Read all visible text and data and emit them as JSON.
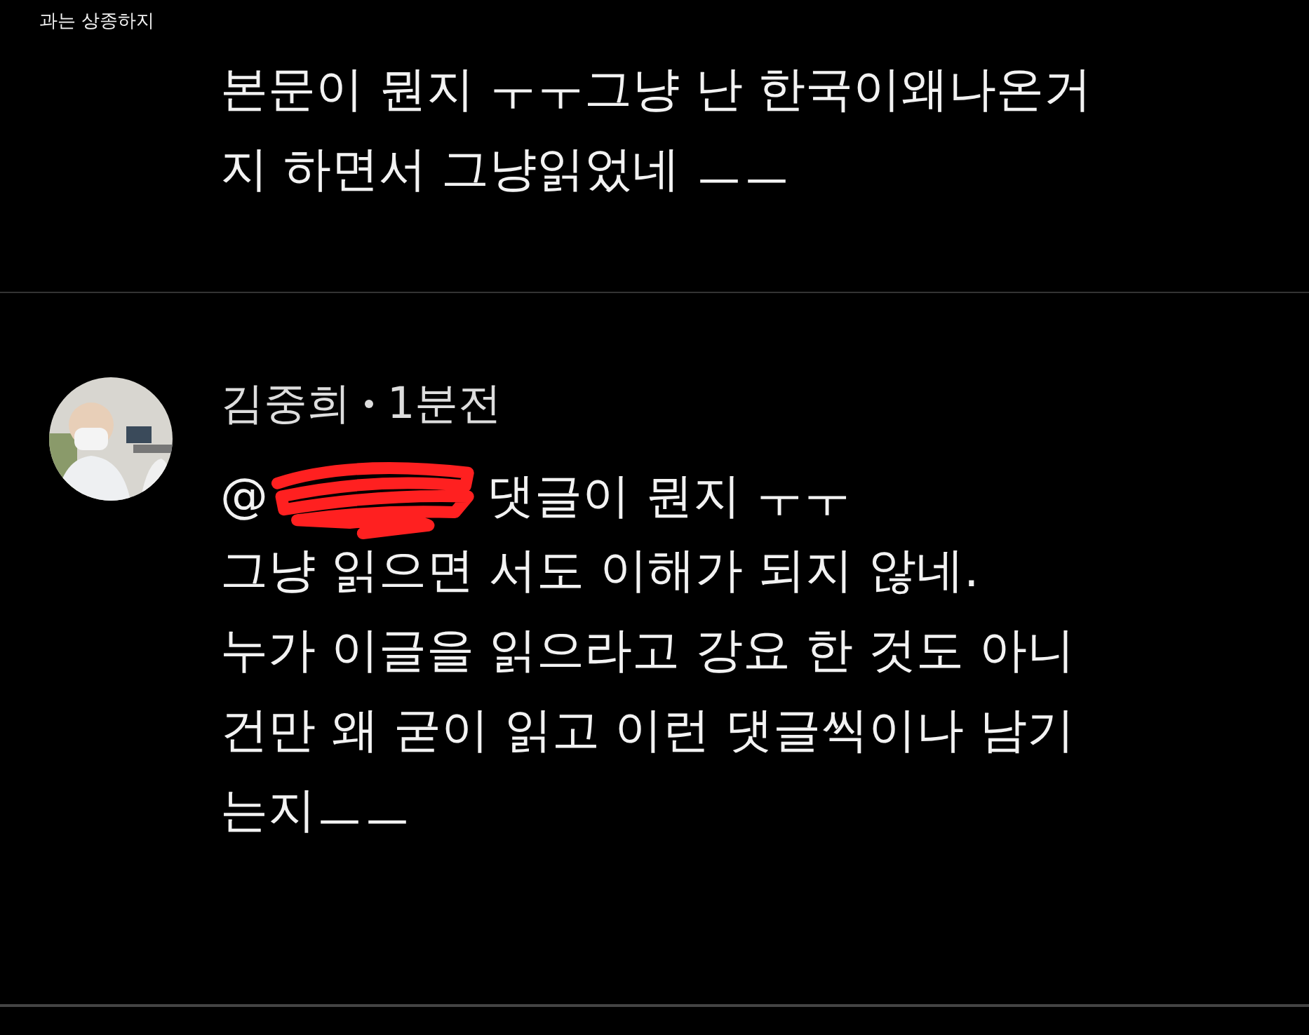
{
  "top_snippet": "과는 상종하지",
  "comments": [
    {
      "body_lines": [
        "본문이 뭔지 ㅜㅜ그냥 난 한국이왜나온거",
        "지 하면서 그냥읽었네 ㅡㅡ"
      ]
    },
    {
      "author": "김중희",
      "time": "1분전",
      "mention": "@",
      "redacted": true,
      "first_line": "댓글이 뭔지 ㅜㅜ",
      "body_lines": [
        "그냥 읽으면 서도 이해가 되지 않네.",
        "누가 이글을 읽으라고 강요 한 것도 아니",
        "건만 왜 굳이 읽고 이런 댓글씩이나 남기",
        "는지ㅡㅡ"
      ]
    }
  ]
}
